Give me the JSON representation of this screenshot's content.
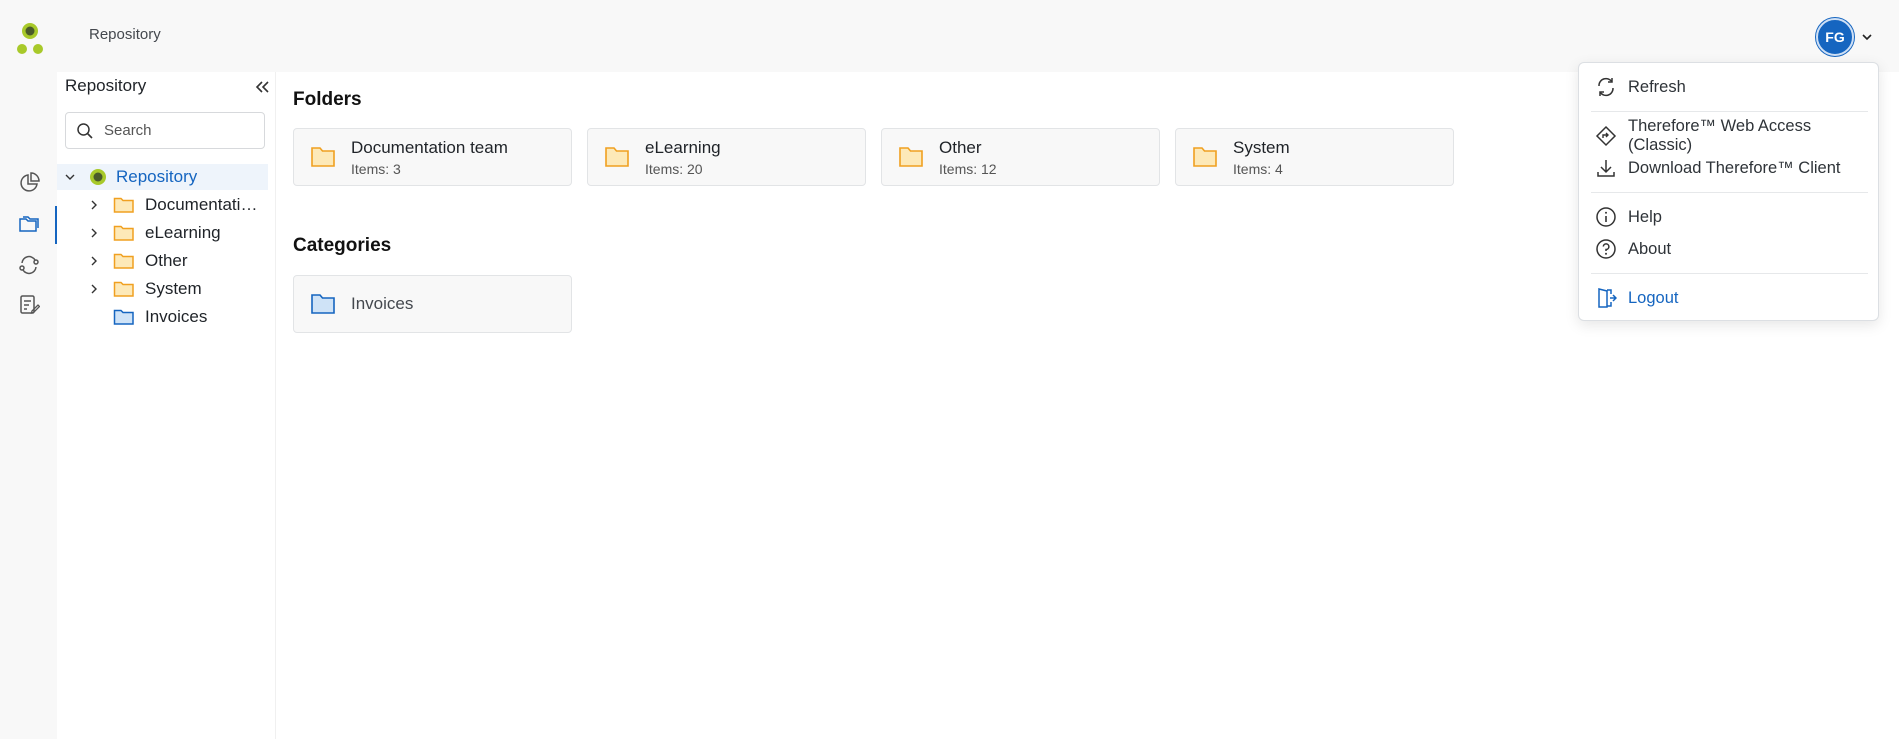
{
  "topbar": {
    "title": "Repository",
    "avatar_initials": "FG"
  },
  "rail": {
    "items": [
      {
        "icon": "dashboard-icon"
      },
      {
        "icon": "repository-folders-icon",
        "active": true
      },
      {
        "icon": "workflow-icon"
      },
      {
        "icon": "tasks-icon"
      }
    ]
  },
  "tree": {
    "header": "Repository",
    "search_placeholder": "Search",
    "root": "Repository",
    "items": [
      {
        "label": "Documentation team",
        "type": "folder"
      },
      {
        "label": "eLearning",
        "type": "folder"
      },
      {
        "label": "Other",
        "type": "folder"
      },
      {
        "label": "System",
        "type": "folder"
      },
      {
        "label": "Invoices",
        "type": "category"
      }
    ]
  },
  "main": {
    "folders_title": "Folders",
    "folders": [
      {
        "name": "Documentation team",
        "count": "Items: 3"
      },
      {
        "name": "eLearning",
        "count": "Items: 20"
      },
      {
        "name": "Other",
        "count": "Items: 12"
      },
      {
        "name": "System",
        "count": "Items: 4"
      }
    ],
    "categories_title": "Categories",
    "categories": [
      {
        "name": "Invoices"
      }
    ]
  },
  "menu": {
    "refresh": "Refresh",
    "web_access": "Therefore™ Web Access (Classic)",
    "download_client": "Download Therefore™ Client",
    "help": "Help",
    "about": "About",
    "logout": "Logout"
  },
  "colors": {
    "accent": "#1565c0",
    "folder": "#f0a020",
    "folder_fill": "#fde9b8",
    "logo_green": "#a8c92a",
    "logo_dark": "#4a5a2a"
  }
}
